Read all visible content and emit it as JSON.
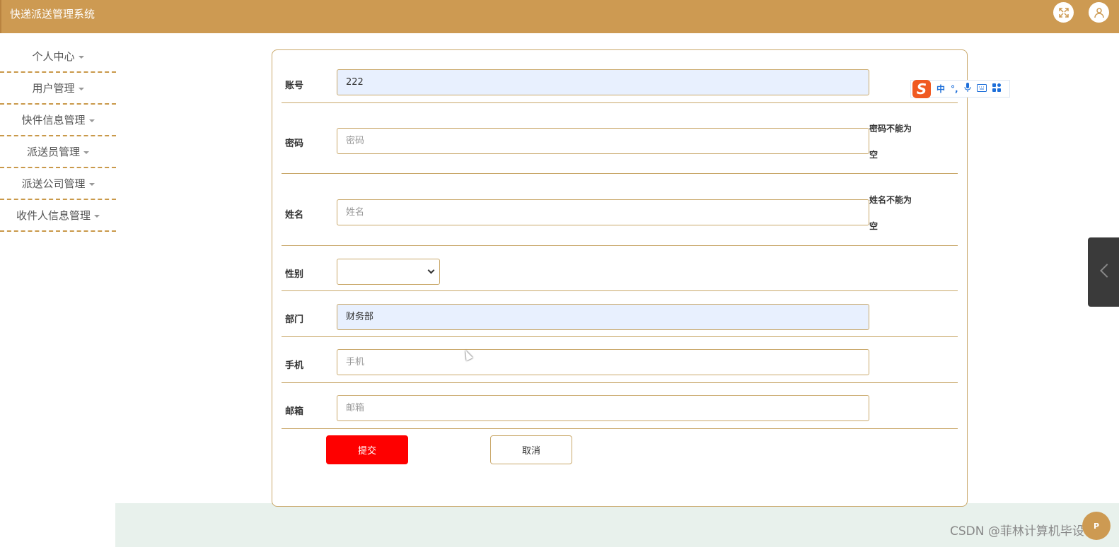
{
  "app": {
    "title": "快递派送管理系统"
  },
  "header": {
    "icons": [
      "fullscreen-icon",
      "user-icon"
    ]
  },
  "sidebar": {
    "items": [
      {
        "label": "个人中心"
      },
      {
        "label": "用户管理"
      },
      {
        "label": "快件信息管理"
      },
      {
        "label": "派送员管理"
      },
      {
        "label": "派送公司管理"
      },
      {
        "label": "收件人信息管理"
      }
    ]
  },
  "form": {
    "account": {
      "label": "账号",
      "value": "222"
    },
    "password": {
      "label": "密码",
      "placeholder": "密码",
      "error": "密码不能为空"
    },
    "name": {
      "label": "姓名",
      "placeholder": "姓名",
      "error": "姓名不能为空"
    },
    "gender": {
      "label": "性别",
      "value": ""
    },
    "department": {
      "label": "部门",
      "value": "财务部"
    },
    "phone": {
      "label": "手机",
      "placeholder": "手机"
    },
    "email": {
      "label": "邮箱",
      "placeholder": "邮箱"
    },
    "submit_label": "提交",
    "cancel_label": "取消"
  },
  "ime": {
    "logo": "S",
    "items": [
      "中",
      "°,",
      "mic-icon",
      "keyboard-icon",
      "grid-icon"
    ]
  },
  "watermark": "CSDN @菲林计算机毕设",
  "corner_badge": "P",
  "colors": {
    "topbar": "#cd9a52",
    "submit": "#fe0000",
    "border": "#c9a86a",
    "footer": "#e8f1ec"
  }
}
